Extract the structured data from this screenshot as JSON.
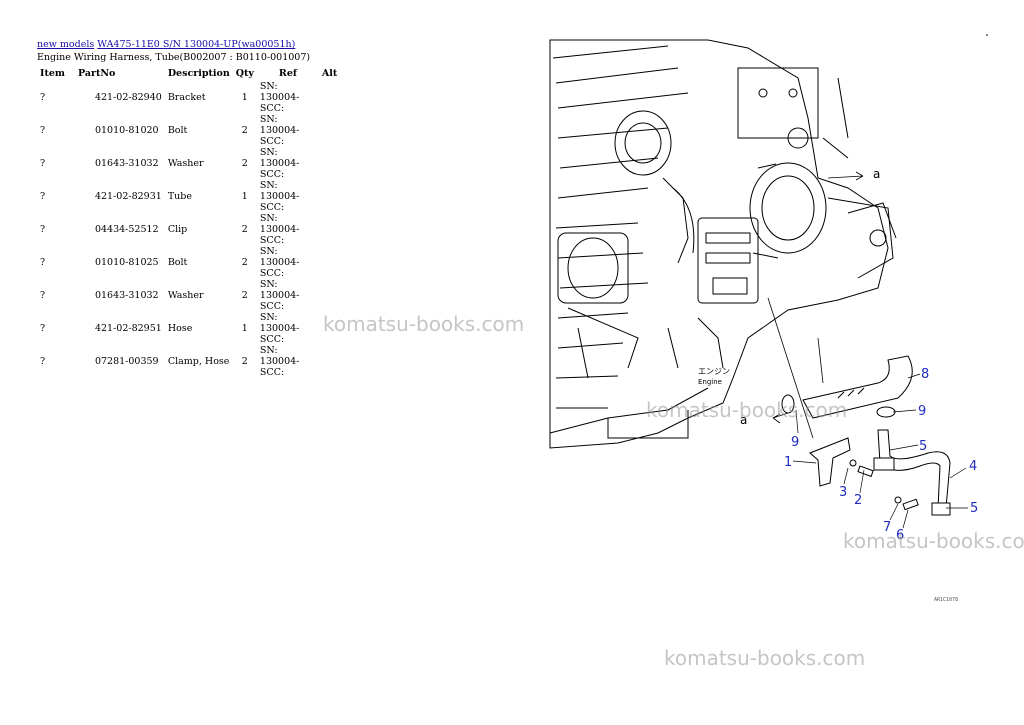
{
  "breadcrumb": {
    "link1": "new models",
    "link2": "WA475-11E0 S/N 130004-UP(wa00051h)"
  },
  "page_title": "Engine Wiring Harness, Tube(B002007 : B0110-001007)",
  "table": {
    "headers": [
      "Item",
      "PartNo",
      "Description",
      "Qty",
      "Ref",
      "Alt"
    ],
    "rows": [
      {
        "item": "?",
        "partno": "421-02-82940",
        "description": "Bracket",
        "qty": "1",
        "ref": "SN: 130004-SCC:",
        "alt": ""
      },
      {
        "item": "?",
        "partno": "01010-81020",
        "description": "Bolt",
        "qty": "2",
        "ref": "SN: 130004-SCC:",
        "alt": ""
      },
      {
        "item": "?",
        "partno": "01643-31032",
        "description": "Washer",
        "qty": "2",
        "ref": "SN: 130004-SCC:",
        "alt": ""
      },
      {
        "item": "?",
        "partno": "421-02-82931",
        "description": "Tube",
        "qty": "1",
        "ref": "SN: 130004-SCC:",
        "alt": ""
      },
      {
        "item": "?",
        "partno": "04434-52512",
        "description": "Clip",
        "qty": "2",
        "ref": "SN: 130004-SCC:",
        "alt": ""
      },
      {
        "item": "?",
        "partno": "01010-81025",
        "description": "Bolt",
        "qty": "2",
        "ref": "SN: 130004-SCC:",
        "alt": ""
      },
      {
        "item": "?",
        "partno": "01643-31032",
        "description": "Washer",
        "qty": "2",
        "ref": "SN: 130004-SCC:",
        "alt": ""
      },
      {
        "item": "?",
        "partno": "421-02-82951",
        "description": "Hose",
        "qty": "1",
        "ref": "SN: 130004-SCC:",
        "alt": ""
      },
      {
        "item": "?",
        "partno": "07281-00359",
        "description": "Clamp, Hose",
        "qty": "2",
        "ref": "SN: 130004-SCC:",
        "alt": ""
      }
    ]
  },
  "diagram": {
    "callouts": [
      "1",
      "2",
      "3",
      "4",
      "5",
      "5",
      "6",
      "7",
      "8",
      "9",
      "9"
    ],
    "arrow_label": "a",
    "arrow_label_2": "a",
    "engine_label_jp": "エンジン",
    "engine_label_en": "Engine",
    "figure_code": "AR1C1078",
    "callout_color": "#1f2bbf"
  },
  "watermarks": [
    "komatsu-books.com",
    "komatsu-books.com",
    "komatsu-books.com",
    "komatsu-books.com"
  ]
}
